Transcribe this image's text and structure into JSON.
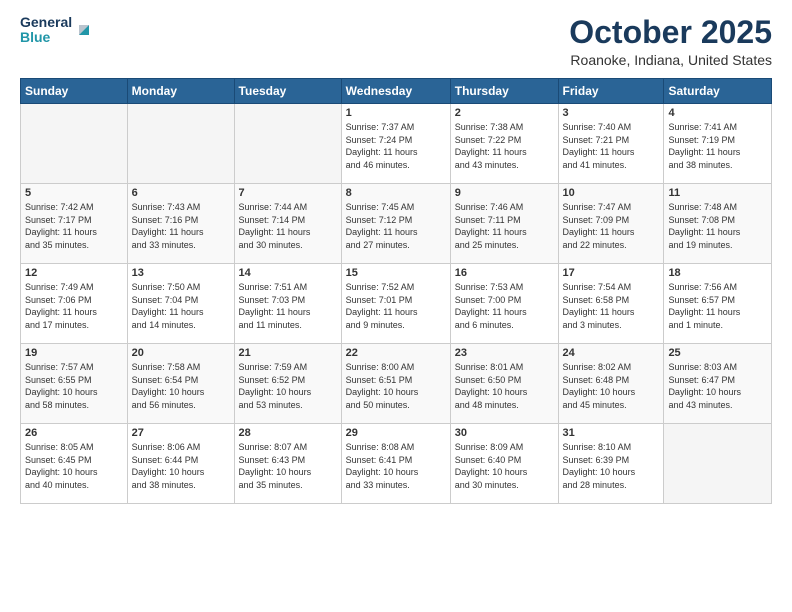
{
  "header": {
    "logo_line1": "General",
    "logo_line2": "Blue",
    "month": "October 2025",
    "location": "Roanoke, Indiana, United States"
  },
  "days_of_week": [
    "Sunday",
    "Monday",
    "Tuesday",
    "Wednesday",
    "Thursday",
    "Friday",
    "Saturday"
  ],
  "weeks": [
    {
      "row_class": "row-odd",
      "days": [
        {
          "num": "",
          "info": "",
          "empty": true
        },
        {
          "num": "",
          "info": "",
          "empty": true
        },
        {
          "num": "",
          "info": "",
          "empty": true
        },
        {
          "num": "1",
          "info": "Sunrise: 7:37 AM\nSunset: 7:24 PM\nDaylight: 11 hours\nand 46 minutes.",
          "empty": false
        },
        {
          "num": "2",
          "info": "Sunrise: 7:38 AM\nSunset: 7:22 PM\nDaylight: 11 hours\nand 43 minutes.",
          "empty": false
        },
        {
          "num": "3",
          "info": "Sunrise: 7:40 AM\nSunset: 7:21 PM\nDaylight: 11 hours\nand 41 minutes.",
          "empty": false
        },
        {
          "num": "4",
          "info": "Sunrise: 7:41 AM\nSunset: 7:19 PM\nDaylight: 11 hours\nand 38 minutes.",
          "empty": false
        }
      ]
    },
    {
      "row_class": "row-even",
      "days": [
        {
          "num": "5",
          "info": "Sunrise: 7:42 AM\nSunset: 7:17 PM\nDaylight: 11 hours\nand 35 minutes.",
          "empty": false
        },
        {
          "num": "6",
          "info": "Sunrise: 7:43 AM\nSunset: 7:16 PM\nDaylight: 11 hours\nand 33 minutes.",
          "empty": false
        },
        {
          "num": "7",
          "info": "Sunrise: 7:44 AM\nSunset: 7:14 PM\nDaylight: 11 hours\nand 30 minutes.",
          "empty": false
        },
        {
          "num": "8",
          "info": "Sunrise: 7:45 AM\nSunset: 7:12 PM\nDaylight: 11 hours\nand 27 minutes.",
          "empty": false
        },
        {
          "num": "9",
          "info": "Sunrise: 7:46 AM\nSunset: 7:11 PM\nDaylight: 11 hours\nand 25 minutes.",
          "empty": false
        },
        {
          "num": "10",
          "info": "Sunrise: 7:47 AM\nSunset: 7:09 PM\nDaylight: 11 hours\nand 22 minutes.",
          "empty": false
        },
        {
          "num": "11",
          "info": "Sunrise: 7:48 AM\nSunset: 7:08 PM\nDaylight: 11 hours\nand 19 minutes.",
          "empty": false
        }
      ]
    },
    {
      "row_class": "row-odd",
      "days": [
        {
          "num": "12",
          "info": "Sunrise: 7:49 AM\nSunset: 7:06 PM\nDaylight: 11 hours\nand 17 minutes.",
          "empty": false
        },
        {
          "num": "13",
          "info": "Sunrise: 7:50 AM\nSunset: 7:04 PM\nDaylight: 11 hours\nand 14 minutes.",
          "empty": false
        },
        {
          "num": "14",
          "info": "Sunrise: 7:51 AM\nSunset: 7:03 PM\nDaylight: 11 hours\nand 11 minutes.",
          "empty": false
        },
        {
          "num": "15",
          "info": "Sunrise: 7:52 AM\nSunset: 7:01 PM\nDaylight: 11 hours\nand 9 minutes.",
          "empty": false
        },
        {
          "num": "16",
          "info": "Sunrise: 7:53 AM\nSunset: 7:00 PM\nDaylight: 11 hours\nand 6 minutes.",
          "empty": false
        },
        {
          "num": "17",
          "info": "Sunrise: 7:54 AM\nSunset: 6:58 PM\nDaylight: 11 hours\nand 3 minutes.",
          "empty": false
        },
        {
          "num": "18",
          "info": "Sunrise: 7:56 AM\nSunset: 6:57 PM\nDaylight: 11 hours\nand 1 minute.",
          "empty": false
        }
      ]
    },
    {
      "row_class": "row-even",
      "days": [
        {
          "num": "19",
          "info": "Sunrise: 7:57 AM\nSunset: 6:55 PM\nDaylight: 10 hours\nand 58 minutes.",
          "empty": false
        },
        {
          "num": "20",
          "info": "Sunrise: 7:58 AM\nSunset: 6:54 PM\nDaylight: 10 hours\nand 56 minutes.",
          "empty": false
        },
        {
          "num": "21",
          "info": "Sunrise: 7:59 AM\nSunset: 6:52 PM\nDaylight: 10 hours\nand 53 minutes.",
          "empty": false
        },
        {
          "num": "22",
          "info": "Sunrise: 8:00 AM\nSunset: 6:51 PM\nDaylight: 10 hours\nand 50 minutes.",
          "empty": false
        },
        {
          "num": "23",
          "info": "Sunrise: 8:01 AM\nSunset: 6:50 PM\nDaylight: 10 hours\nand 48 minutes.",
          "empty": false
        },
        {
          "num": "24",
          "info": "Sunrise: 8:02 AM\nSunset: 6:48 PM\nDaylight: 10 hours\nand 45 minutes.",
          "empty": false
        },
        {
          "num": "25",
          "info": "Sunrise: 8:03 AM\nSunset: 6:47 PM\nDaylight: 10 hours\nand 43 minutes.",
          "empty": false
        }
      ]
    },
    {
      "row_class": "row-odd",
      "days": [
        {
          "num": "26",
          "info": "Sunrise: 8:05 AM\nSunset: 6:45 PM\nDaylight: 10 hours\nand 40 minutes.",
          "empty": false
        },
        {
          "num": "27",
          "info": "Sunrise: 8:06 AM\nSunset: 6:44 PM\nDaylight: 10 hours\nand 38 minutes.",
          "empty": false
        },
        {
          "num": "28",
          "info": "Sunrise: 8:07 AM\nSunset: 6:43 PM\nDaylight: 10 hours\nand 35 minutes.",
          "empty": false
        },
        {
          "num": "29",
          "info": "Sunrise: 8:08 AM\nSunset: 6:41 PM\nDaylight: 10 hours\nand 33 minutes.",
          "empty": false
        },
        {
          "num": "30",
          "info": "Sunrise: 8:09 AM\nSunset: 6:40 PM\nDaylight: 10 hours\nand 30 minutes.",
          "empty": false
        },
        {
          "num": "31",
          "info": "Sunrise: 8:10 AM\nSunset: 6:39 PM\nDaylight: 10 hours\nand 28 minutes.",
          "empty": false
        },
        {
          "num": "",
          "info": "",
          "empty": true
        }
      ]
    }
  ]
}
